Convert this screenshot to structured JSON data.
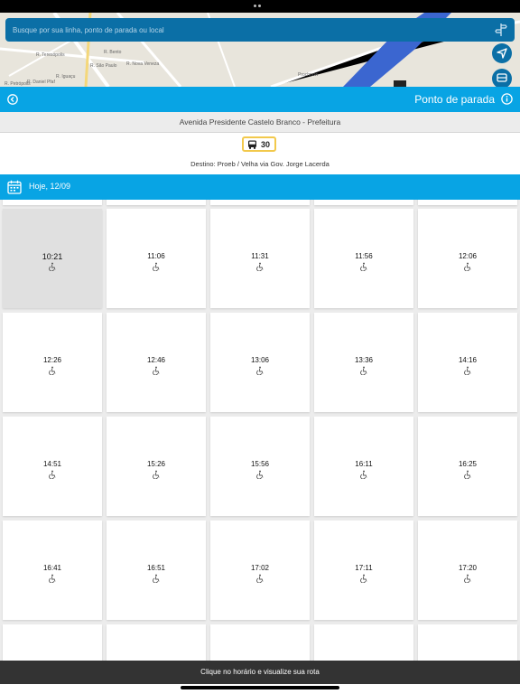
{
  "search": {
    "placeholder": "Busque por sua linha, ponto de parada ou local"
  },
  "map": {
    "street_labels": [
      "R. Daniel Pfaf",
      "R. Teresópolis",
      "R. Petrópolis",
      "R. Iguaçu",
      "R. São Paulo",
      "R. Bento",
      "R. Nova Veneza",
      "Prochnow"
    ]
  },
  "header": {
    "title": "Ponto de parada"
  },
  "stop": {
    "name": "Avenida Presidente Castelo Branco - Prefeitura"
  },
  "line": {
    "number": "30",
    "destination": "Destino: Proeb / Velha via Gov. Jorge Lacerda",
    "badge_color": "#f2c94c"
  },
  "date": {
    "label": "Hoje, 12/09"
  },
  "times": [
    "10:21",
    "11:06",
    "11:31",
    "11:56",
    "12:06",
    "12:26",
    "12:46",
    "13:06",
    "13:36",
    "14:16",
    "14:51",
    "15:26",
    "15:56",
    "16:11",
    "16:25",
    "16:41",
    "16:51",
    "17:02",
    "17:11",
    "17:20"
  ],
  "selected_time": "10:21",
  "footer": {
    "hint": "Clique no horário e visualize sua rota"
  },
  "colors": {
    "primary": "#08a4e4",
    "search_bg": "#0b6fa6",
    "footer_bg": "#333333"
  },
  "icons": [
    "route-icon",
    "navigation-icon",
    "bus-icon",
    "back-icon",
    "info-icon",
    "calendar-icon",
    "accessibility-icon"
  ]
}
